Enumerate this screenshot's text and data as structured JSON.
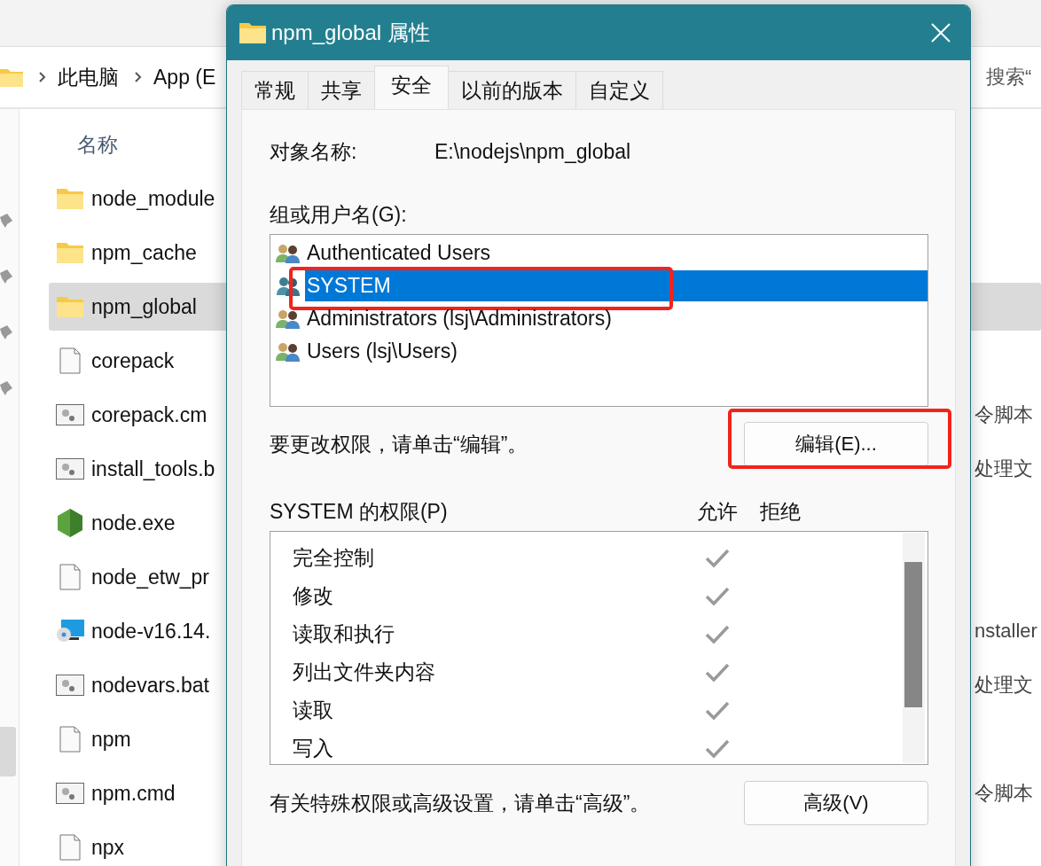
{
  "explorer": {
    "breadcrumb": [
      "此电脑",
      "App (E"
    ],
    "search_placeholder": "搜索“",
    "column_header": "名称",
    "files": [
      {
        "name": "node_module",
        "kind": "folder",
        "selected": false
      },
      {
        "name": "npm_cache",
        "kind": "folder",
        "selected": false
      },
      {
        "name": "npm_global",
        "kind": "folder",
        "selected": true
      },
      {
        "name": "corepack",
        "kind": "file",
        "selected": false
      },
      {
        "name": "corepack.cm",
        "kind": "script",
        "type": "令脚本",
        "selected": false
      },
      {
        "name": "install_tools.b",
        "kind": "script",
        "type": "处理文",
        "selected": false
      },
      {
        "name": "node.exe",
        "kind": "node",
        "selected": false
      },
      {
        "name": "node_etw_pr",
        "kind": "file",
        "selected": false
      },
      {
        "name": "node-v16.14.",
        "kind": "installer",
        "type": "nstaller",
        "selected": false
      },
      {
        "name": "nodevars.bat",
        "kind": "script",
        "type": "处理文",
        "selected": false
      },
      {
        "name": "npm",
        "kind": "file",
        "selected": false
      },
      {
        "name": "npm.cmd",
        "kind": "script",
        "type": "令脚本",
        "selected": false
      },
      {
        "name": "npx",
        "kind": "file",
        "selected": false
      }
    ]
  },
  "dialog": {
    "title": "npm_global 属性",
    "tabs": [
      {
        "label": "常规",
        "selected": false
      },
      {
        "label": "共享",
        "selected": false
      },
      {
        "label": "安全",
        "selected": true
      },
      {
        "label": "以前的版本",
        "selected": false
      },
      {
        "label": "自定义",
        "selected": false
      }
    ],
    "object_name_label": "对象名称:",
    "object_name": "E:\\nodejs\\npm_global",
    "groups_label": "组或用户名(G):",
    "users": [
      {
        "name": "Authenticated Users",
        "kind": "group",
        "selected": false,
        "highlighted": false
      },
      {
        "name": "SYSTEM",
        "kind": "system",
        "selected": true,
        "highlighted": true
      },
      {
        "name": "Administrators (lsj\\Administrators)",
        "kind": "group",
        "selected": false,
        "highlighted": false
      },
      {
        "name": "Users (lsj\\Users)",
        "kind": "group",
        "selected": false,
        "highlighted": false
      }
    ],
    "change_hint": "要更改权限，请单击“编辑”。",
    "edit_button": {
      "label": "编辑(E)...",
      "highlighted": true
    },
    "permissions_label": "SYSTEM 的权限(P)",
    "allow_header": "允许",
    "deny_header": "拒绝",
    "permissions": [
      {
        "name": "完全控制",
        "allow": true,
        "deny": false
      },
      {
        "name": "修改",
        "allow": true,
        "deny": false
      },
      {
        "name": "读取和执行",
        "allow": true,
        "deny": false
      },
      {
        "name": "列出文件夹内容",
        "allow": true,
        "deny": false
      },
      {
        "name": "读取",
        "allow": true,
        "deny": false
      },
      {
        "name": "写入",
        "allow": true,
        "deny": false
      }
    ],
    "advanced_hint": "有关特殊权限或高级设置，请单击“高级”。",
    "advanced_button": {
      "label": "高级(V)",
      "highlighted": false
    }
  }
}
